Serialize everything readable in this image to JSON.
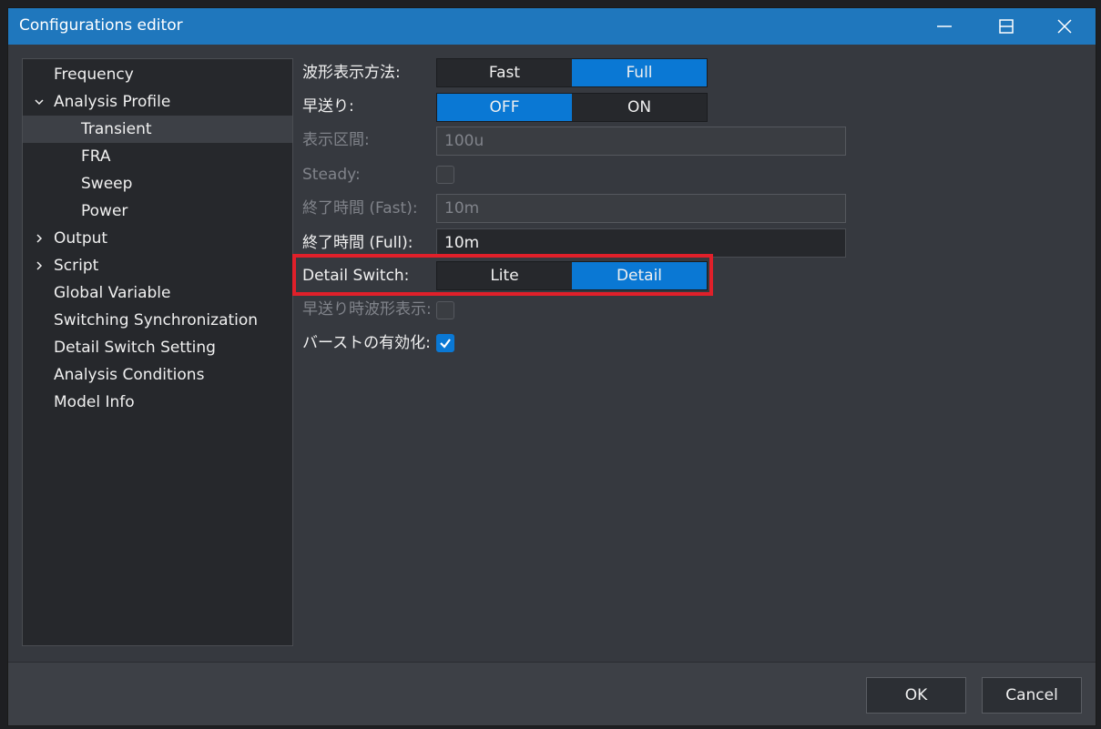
{
  "window": {
    "title": "Configurations editor"
  },
  "tree": {
    "items": [
      {
        "label": "Frequency"
      },
      {
        "label": "Analysis Profile"
      },
      {
        "label": "Transient"
      },
      {
        "label": "FRA"
      },
      {
        "label": "Sweep"
      },
      {
        "label": "Power"
      },
      {
        "label": "Output"
      },
      {
        "label": "Script"
      },
      {
        "label": "Global Variable"
      },
      {
        "label": "Switching Synchronization"
      },
      {
        "label": "Detail Switch Setting"
      },
      {
        "label": "Analysis Conditions"
      },
      {
        "label": "Model Info"
      }
    ],
    "selected": "Transient"
  },
  "form": {
    "waveform_method": {
      "label": "波形表示方法:",
      "options": [
        "Fast",
        "Full"
      ],
      "selected": "Full"
    },
    "fast_forward": {
      "label": "早送り:",
      "options": [
        "OFF",
        "ON"
      ],
      "selected": "OFF"
    },
    "display_interval": {
      "label": "表示区間:",
      "value": "100u"
    },
    "steady": {
      "label": "Steady:",
      "checked": false
    },
    "end_time_fast": {
      "label": "終了時間 (Fast):",
      "value": "10m"
    },
    "end_time_full": {
      "label": "終了時間 (Full):",
      "value": "10m"
    },
    "detail_switch": {
      "label": "Detail Switch:",
      "options": [
        "Lite",
        "Detail"
      ],
      "selected": "Detail"
    },
    "ff_waveform_display": {
      "label": "早送り時波形表示:",
      "checked": false
    },
    "burst_enable": {
      "label": "バーストの有効化:",
      "checked": true
    }
  },
  "footer": {
    "ok_label": "OK",
    "cancel_label": "Cancel"
  },
  "colors": {
    "titlebar": "#1f77bd",
    "accent": "#0a78d4",
    "highlight": "#e0202a"
  }
}
